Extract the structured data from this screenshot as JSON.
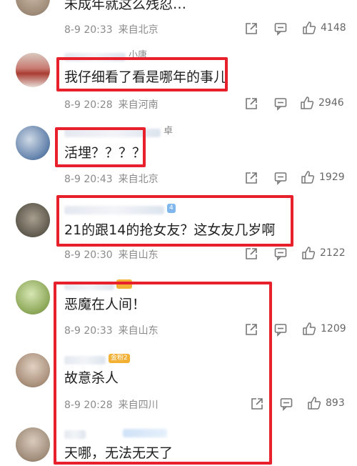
{
  "comments": [
    {
      "name": "",
      "text": "未成年就这么残忍…",
      "date": "8-9 20:33",
      "location": "来自北京",
      "likes": "4148"
    },
    {
      "name": "小唐",
      "text": "我仔细看了看是哪年的事儿",
      "date": "8-9 20:28",
      "location": "来自河南",
      "likes": "2946"
    },
    {
      "name": "卓",
      "text": "活埋？？？？",
      "date": "8-9 20:43",
      "location": "来自北京",
      "likes": "1929"
    },
    {
      "name": "",
      "badge": "4",
      "text": "21的跟14的抢女友？这女友几岁啊",
      "date": "8-9 20:30",
      "location": "来自山东",
      "likes": "2122"
    },
    {
      "name": "",
      "text": "恶魔在人间！",
      "date": "8-9 20:33",
      "location": "来自山东",
      "likes": "1209"
    },
    {
      "name": "",
      "badge": "金粉2",
      "text": "故意杀人",
      "date": "8-9 20:28",
      "location": "来自四川",
      "likes": "893"
    },
    {
      "name": "",
      "text": "天哪，无法无天了",
      "date": "",
      "location": "",
      "likes": ""
    }
  ],
  "icons": {
    "share": "share-icon",
    "comment": "comment-icon",
    "like": "thumbs-up-icon"
  },
  "colors": {
    "highlight": "#e8202c",
    "meta": "#8b8b8b",
    "badge_gold": "#f2b035"
  }
}
